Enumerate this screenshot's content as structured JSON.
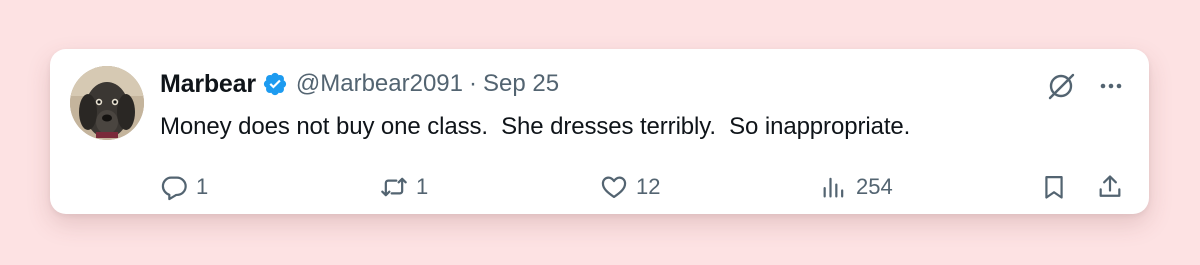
{
  "tweet": {
    "display_name": "Marbear",
    "handle": "@Marbear2091",
    "separator": "·",
    "date": "Sep 25",
    "text": "Money does not buy one class.  She dresses terribly.  So inappropriate.",
    "verified": true,
    "avatar_icon": "dog-avatar"
  },
  "actions": {
    "reply": {
      "icon": "reply-icon",
      "count": "1"
    },
    "retweet": {
      "icon": "retweet-icon",
      "count": "1"
    },
    "like": {
      "icon": "heart-icon",
      "count": "12"
    },
    "views": {
      "icon": "views-icon",
      "count": "254"
    },
    "bookmark": {
      "icon": "bookmark-icon"
    },
    "share": {
      "icon": "share-icon"
    }
  },
  "header_icons": {
    "grok": "grok-icon",
    "more": "more-icon"
  },
  "colors": {
    "background": "#fde2e3",
    "card": "#ffffff",
    "text": "#0f1419",
    "muted": "#536471",
    "verified": "#1d9bf0"
  }
}
